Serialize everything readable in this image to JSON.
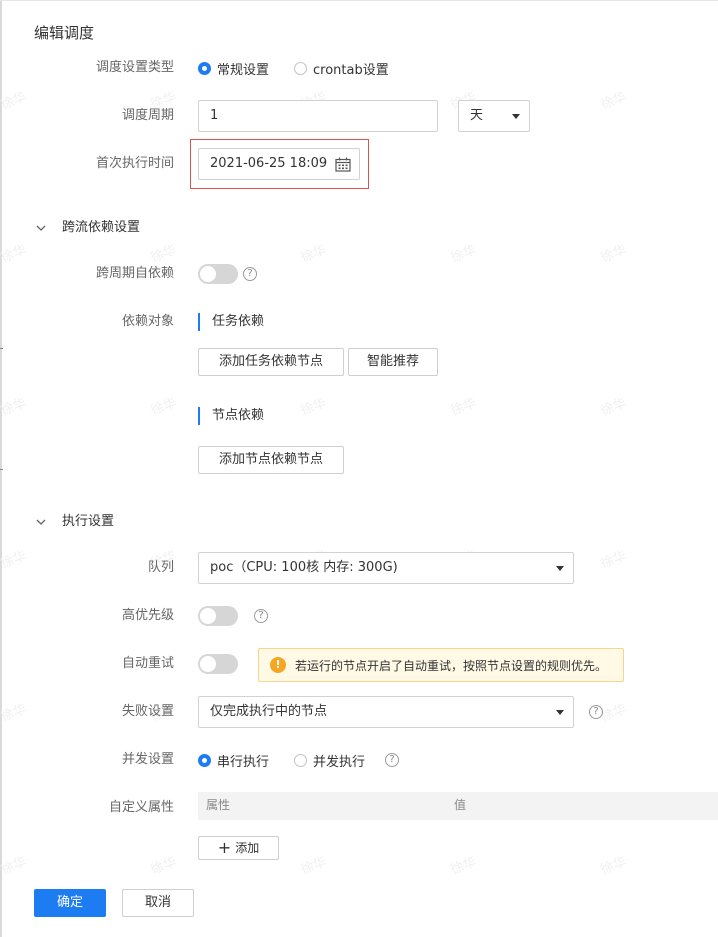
{
  "title": "编辑调度",
  "schedule": {
    "type_label": "调度设置类型",
    "type_options": [
      "常规设置",
      "crontab设置"
    ],
    "type_selected": 0,
    "period_label": "调度周期",
    "period_value": "1",
    "period_unit": "天",
    "first_run_label": "首次执行时间",
    "first_run_value": "2021-06-25 18:09"
  },
  "cross_flow": {
    "section_title": "跨流依赖设置",
    "self_dep_label": "跨周期自依赖",
    "self_dep_on": false,
    "dep_object_label": "依赖对象",
    "task_dep_title": "任务依赖",
    "add_task_dep_button": "添加任务依赖节点",
    "smart_recommend_button": "智能推荐",
    "node_dep_title": "节点依赖",
    "add_node_dep_button": "添加节点依赖节点"
  },
  "execution": {
    "section_title": "执行设置",
    "queue_label": "队列",
    "queue_value": "poc（CPU: 100核 内存: 300G)",
    "high_priority_label": "高优先级",
    "high_priority_on": false,
    "auto_retry_label": "自动重试",
    "auto_retry_on": false,
    "auto_retry_notice": "若运行的节点开启了自动重试，按照节点设置的规则优先。",
    "failure_label": "失败设置",
    "failure_value": "仅完成执行中的节点",
    "concurrency_label": "并发设置",
    "concurrency_options": [
      "串行执行",
      "并发执行"
    ],
    "concurrency_selected": 0,
    "custom_attr_label": "自定义属性",
    "attr_columns": [
      "属性",
      "值"
    ],
    "add_button": "添加"
  },
  "footer": {
    "confirm_button": "确定",
    "cancel_button": "取消"
  },
  "watermark": "徐华",
  "colors": {
    "primary": "#1e7cf3",
    "highlight_border": "#d9534f",
    "warning": "#f5a623"
  }
}
